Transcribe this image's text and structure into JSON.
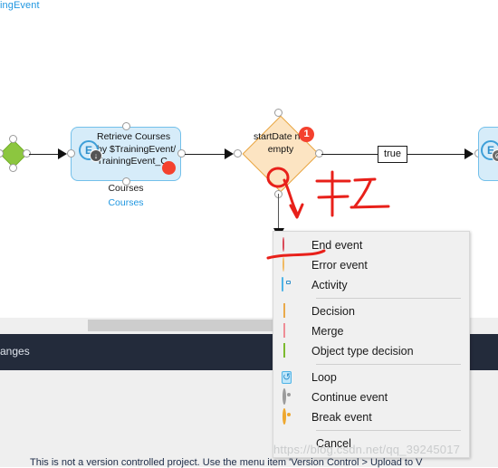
{
  "top_label": "ingEvent",
  "canvas": {
    "start_node": {
      "name": "start-object-type-decision",
      "color": "#8cc63f"
    },
    "activity": {
      "text": "Retrieve Courses by $TrainingEvent/TrainingEvent_C",
      "icon_letter": "E",
      "badge_glyph": "↓",
      "label": "Courses",
      "sublabel": "Courses",
      "error_marker": true,
      "fill": "#d6ecf9",
      "stroke": "#73c0ea"
    },
    "decision": {
      "text": "startDate not empty",
      "badge": "1",
      "badge_color": "#f4412e",
      "fill": "#fce4c2",
      "stroke": "#e8a33d"
    },
    "condition_label": "true",
    "end_activity": {
      "icon_letter": "E",
      "fill": "#d6ecf9",
      "stroke": "#73c0ea"
    }
  },
  "context_menu": {
    "items": [
      {
        "label": "End event",
        "icon": "filled-circle-red-icon"
      },
      {
        "label": "Error event",
        "icon": "open-circle-orange-icon"
      },
      {
        "label": "Activity",
        "icon": "activity-square-icon"
      },
      {
        "label": "Decision",
        "icon": "diamond-orange-icon"
      },
      {
        "label": "Merge",
        "icon": "diamond-pink-icon"
      },
      {
        "label": "Object type decision",
        "icon": "diamond-green-icon"
      },
      {
        "label": "Loop",
        "icon": "loop-refresh-icon"
      },
      {
        "label": "Continue event",
        "icon": "ring-gray-icon"
      },
      {
        "label": "Break event",
        "icon": "ring-orange-icon"
      },
      {
        "label": "Cancel",
        "icon": "none"
      }
    ]
  },
  "dark_bar": {
    "title": "anges"
  },
  "bottom_panel": {
    "message": "This is not a version controlled project. Use the menu item 'Version Control > Upload to V"
  },
  "watermark": "https://blog.csdn.net/qq_39245017"
}
